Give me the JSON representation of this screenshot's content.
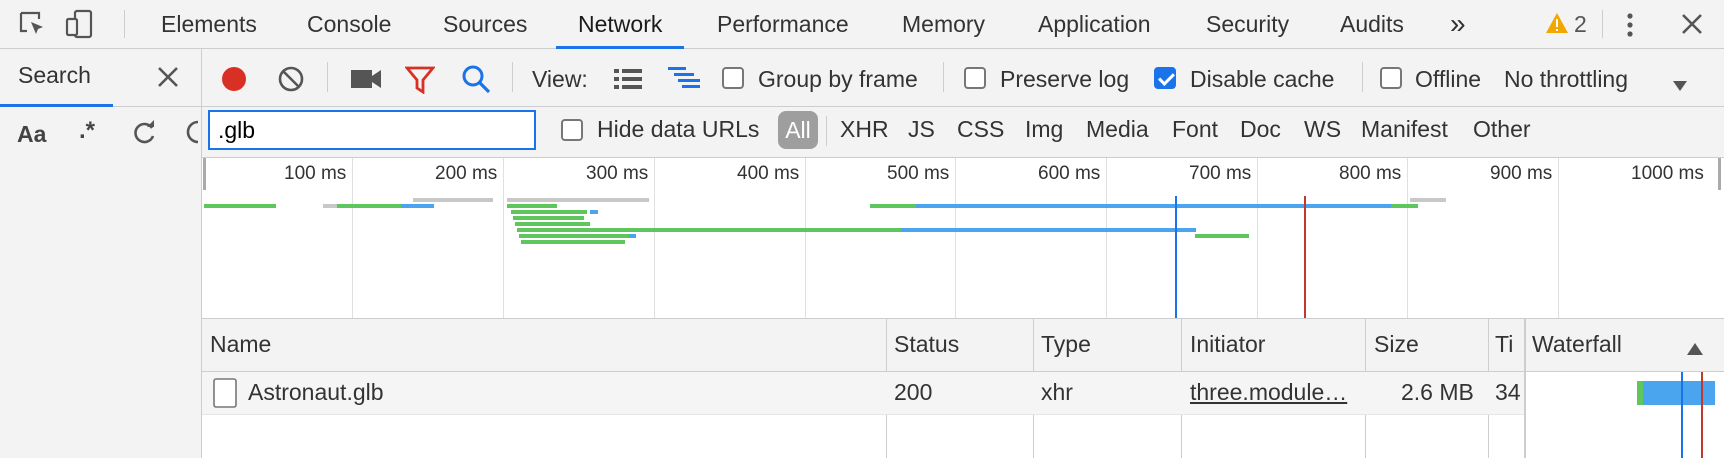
{
  "tabs": [
    "Elements",
    "Console",
    "Sources",
    "Network",
    "Performance",
    "Memory",
    "Application",
    "Security",
    "Audits"
  ],
  "active_tab": "Network",
  "overflow_label": "»",
  "warning_count": "2",
  "search_panel": {
    "title": "Search",
    "match_case_label": "Aa",
    "regex_label": ".*"
  },
  "toolbar": {
    "view_label": "View:",
    "group_by_frame": "Group by frame",
    "preserve_log": "Preserve log",
    "disable_cache": "Disable cache",
    "offline": "Offline",
    "throttling": "No throttling"
  },
  "filter": {
    "value": ".glb",
    "hide_data_urls": "Hide data URLs",
    "types": [
      "All",
      "XHR",
      "JS",
      "CSS",
      "Img",
      "Media",
      "Font",
      "Doc",
      "WS",
      "Manifest",
      "Other"
    ]
  },
  "overview": {
    "ticks": [
      "100 ms",
      "200 ms",
      "300 ms",
      "400 ms",
      "500 ms",
      "600 ms",
      "700 ms",
      "800 ms",
      "900 ms",
      "1000 ms"
    ]
  },
  "table": {
    "columns": {
      "name": "Name",
      "status": "Status",
      "type": "Type",
      "initiator": "Initiator",
      "size": "Size",
      "time": "Ti",
      "waterfall": "Waterfall"
    },
    "rows": [
      {
        "name": "Astronaut.glb",
        "status": "200",
        "type": "xhr",
        "initiator": "three.module…",
        "size": "2.6 MB",
        "time": "34"
      }
    ]
  },
  "colors": {
    "accent": "#1a73e8",
    "record": "#d93025",
    "green": "#5fc65e",
    "blue": "#4aa5ee"
  }
}
